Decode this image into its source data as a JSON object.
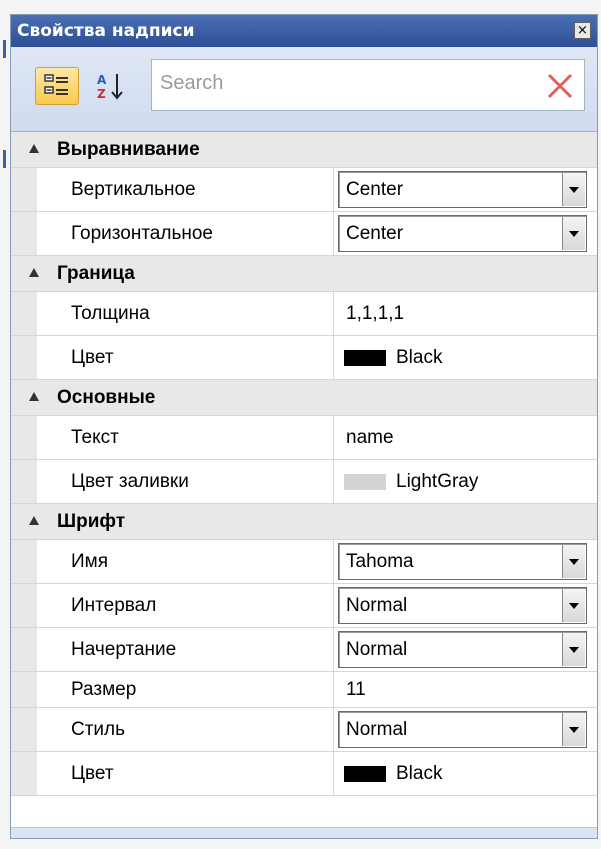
{
  "window": {
    "title": "Свойства надписи",
    "close_glyph": "×"
  },
  "toolbar": {
    "categorized_icon": "categorized-icon",
    "alphabetical_icon": "alphabetical-sort-icon",
    "search_placeholder": "Search",
    "clear_icon": "clear-search-icon"
  },
  "colors": {
    "titlebar": "#2e4f95",
    "toolbar_bg": "#d6e0f2",
    "selected_button": "#f8c94e",
    "clear_icon": "#e06060",
    "black_swatch": "#000000",
    "lightgray_swatch": "#d3d3d3"
  },
  "grid": {
    "alignment": {
      "label": "Выравнивание",
      "vertical": {
        "name": "Вертикальное",
        "value": "Center"
      },
      "horizontal": {
        "name": "Горизонтальное",
        "value": "Center"
      }
    },
    "border": {
      "label": "Граница",
      "thickness": {
        "name": "Толщина",
        "value": "1,1,1,1"
      },
      "color": {
        "name": "Цвет",
        "value": "Black"
      }
    },
    "basic": {
      "label": "Основные",
      "text": {
        "name": "Текст",
        "value": "name"
      },
      "fill_color": {
        "name": "Цвет заливки",
        "value": "LightGray"
      }
    },
    "font": {
      "label": "Шрифт",
      "name": {
        "name": "Имя",
        "value": "Tahoma"
      },
      "spacing": {
        "name": "Интервал",
        "value": "Normal"
      },
      "weight": {
        "name": "Начертание",
        "value": "Normal"
      },
      "size": {
        "name": "Размер",
        "value": "11"
      },
      "style": {
        "name": "Стиль",
        "value": "Normal"
      },
      "color": {
        "name": "Цвет",
        "value": "Black"
      }
    }
  }
}
